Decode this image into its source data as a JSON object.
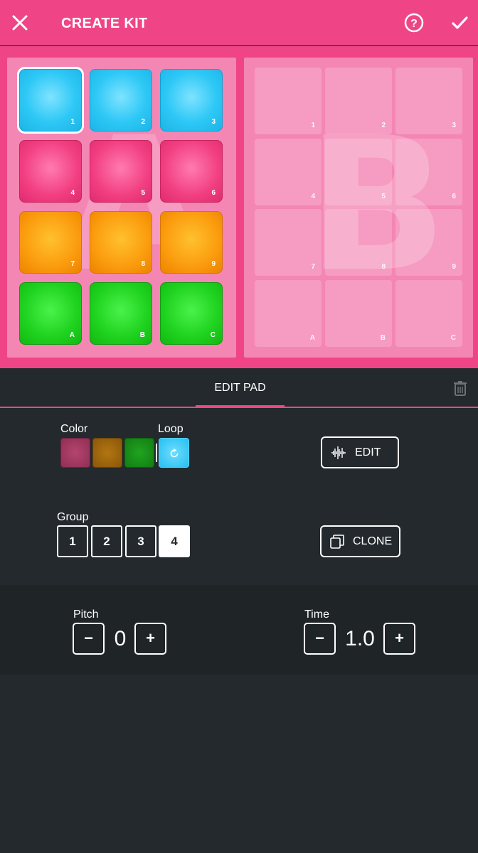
{
  "header": {
    "title": "CREATE KIT"
  },
  "bank_a": {
    "letter": "A",
    "pads": [
      {
        "label": "1",
        "color": "#2ec8f6",
        "selected": true
      },
      {
        "label": "2",
        "color": "#2ec8f6"
      },
      {
        "label": "3",
        "color": "#2ec8f6"
      },
      {
        "label": "4",
        "color": "#f23f82"
      },
      {
        "label": "5",
        "color": "#f23f82"
      },
      {
        "label": "6",
        "color": "#f23f82"
      },
      {
        "label": "7",
        "color": "#fb9c0e"
      },
      {
        "label": "8",
        "color": "#fb9c0e"
      },
      {
        "label": "9",
        "color": "#fb9c0e"
      },
      {
        "label": "A",
        "color": "#1fd21f"
      },
      {
        "label": "B",
        "color": "#1fd21f"
      },
      {
        "label": "C",
        "color": "#1fd21f"
      }
    ]
  },
  "bank_b": {
    "letter": "B",
    "pads": [
      {
        "label": "1"
      },
      {
        "label": "2"
      },
      {
        "label": "3"
      },
      {
        "label": "4"
      },
      {
        "label": "5"
      },
      {
        "label": "6"
      },
      {
        "label": "7"
      },
      {
        "label": "8"
      },
      {
        "label": "9"
      },
      {
        "label": "A"
      },
      {
        "label": "B"
      },
      {
        "label": "C"
      }
    ]
  },
  "tabs": {
    "active_label": "EDIT PAD"
  },
  "color_section": {
    "color_label": "Color",
    "loop_label": "Loop",
    "swatches": [
      "#b5446e",
      "#b37512",
      "#1fa41f"
    ],
    "loop_color": "#25c0f0"
  },
  "edit_button": {
    "label": "EDIT"
  },
  "clone_button": {
    "label": "CLONE"
  },
  "group": {
    "label": "Group",
    "options": [
      "1",
      "2",
      "3",
      "4"
    ],
    "selected": "4"
  },
  "pitch": {
    "label": "Pitch",
    "value": "0",
    "minus": "−",
    "plus": "+"
  },
  "time": {
    "label": "Time",
    "value": "1.0",
    "minus": "−",
    "plus": "+"
  },
  "colors": {
    "accent": "#ef4587",
    "background": "#23292d"
  }
}
